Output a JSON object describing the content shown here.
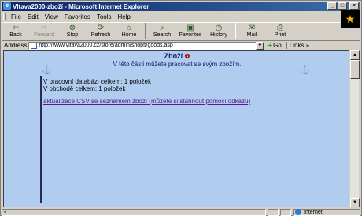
{
  "window": {
    "title": "Vltava2000-zboží - Microsoft Internet Explorer",
    "controls": [
      "_",
      "□",
      "×"
    ]
  },
  "menu": [
    {
      "label": "File",
      "key": "F"
    },
    {
      "label": "Edit",
      "key": "E"
    },
    {
      "label": "View",
      "key": "V"
    },
    {
      "label": "Favorites",
      "key": "a"
    },
    {
      "label": "Tools",
      "key": "T"
    },
    {
      "label": "Help",
      "key": "H"
    }
  ],
  "toolbar": {
    "back": "Back",
    "forward": "Forward",
    "stop": "Stop",
    "refresh": "Refresh",
    "home": "Home",
    "search": "Search",
    "favorites": "Favorites",
    "history": "History",
    "mail": "Mail",
    "print": "Print",
    "more": "»"
  },
  "address": {
    "label": "Address",
    "url": "http://www.vltava2000.cz/store/admin/shops/goods.asp",
    "go": "Go",
    "links": "Links »"
  },
  "page": {
    "title": "Zboží",
    "subtitle": "V této části můžete pracovat se svým zbožím.",
    "line1": "V pracovní databázi celkem: 1 položek",
    "line2": "V obchodě celkem: 1 položek",
    "csv_link": "aktualizace CSV se seznamem zboží (můžete si stáhnout pomocí odkazu)"
  },
  "status": {
    "text": "",
    "zone": "Internet"
  },
  "colors": {
    "page_background": "#b0ccee",
    "heading": "#0a246a",
    "visited_link": "#5a1a8a"
  }
}
